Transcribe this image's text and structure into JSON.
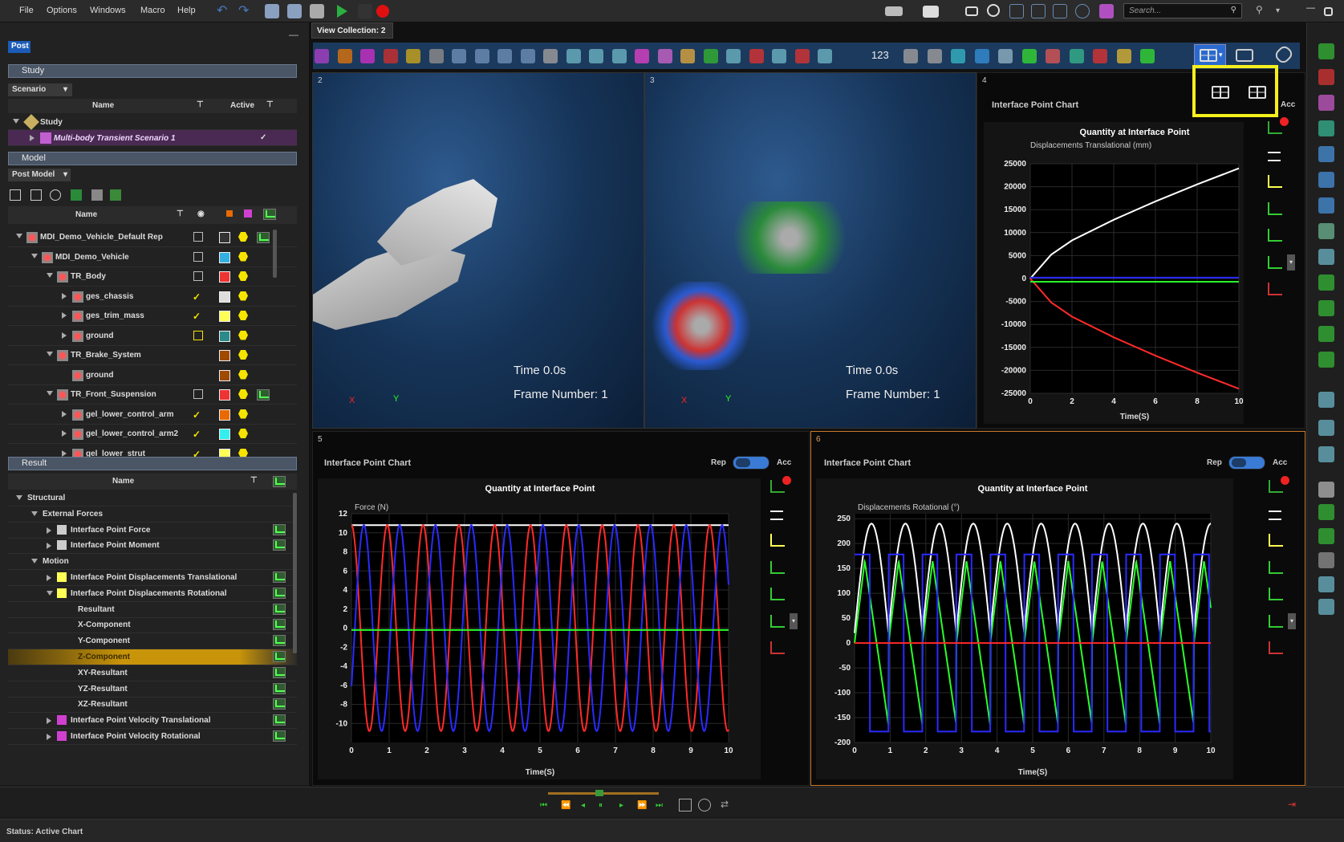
{
  "menu": {
    "file": "File",
    "options": "Options",
    "windows": "Windows",
    "macro": "Macro",
    "help": "Help",
    "search_placeholder": "Search..."
  },
  "tabs": {
    "post": "Post",
    "view_collection": "View Collection: 2"
  },
  "study": {
    "section": "Study",
    "scenario_dropdown": "Scenario",
    "col_name": "Name",
    "col_active": "Active",
    "root": "Study",
    "scenario": "Multi-body Transient Scenario 1",
    "active_mark": "✓"
  },
  "model": {
    "section": "Model",
    "dropdown": "Post Model",
    "col_name": "Name",
    "rows": [
      "MDI_Demo_Vehicle_Default Rep",
      "MDI_Demo_Vehicle",
      "TR_Body",
      "ges_chassis",
      "ges_trim_mass",
      "ground",
      "TR_Brake_System",
      "ground",
      "TR_Front_Suspension",
      "gel_lower_control_arm",
      "gel_lower_control_arm2",
      "gel_lower_strut"
    ]
  },
  "result": {
    "section": "Result",
    "col_name": "Name",
    "rows": [
      "Structural",
      "External Forces",
      "Interface Point Force",
      "Interface Point Moment",
      "Motion",
      "Interface Point Displacements Translational",
      "Interface Point Displacements Rotational",
      "Resultant",
      "X-Component",
      "Y-Component",
      "Z-Component",
      "XY-Resultant",
      "YZ-Resultant",
      "XZ-Resultant",
      "Interface Point Velocity Translational",
      "Interface Point Velocity Rotational"
    ]
  },
  "toolbar": {
    "counter": "123"
  },
  "views": {
    "v2": {
      "num": "2",
      "time": "Time  0.0s",
      "frame": "Frame  Number:  1",
      "axis_x": "X",
      "axis_y": "Y"
    },
    "v3": {
      "num": "3",
      "time": "Time  0.0s",
      "frame": "Frame  Number:  1",
      "axis_x": "X",
      "axis_y": "Y"
    }
  },
  "charts": {
    "c4": {
      "num": "4",
      "panel_title": "Interface Point Chart",
      "acc": "Acc"
    },
    "c5": {
      "num": "5",
      "panel_title": "Interface Point Chart",
      "rep": "Rep",
      "acc": "Acc"
    },
    "c6": {
      "num": "6",
      "panel_title": "Interface Point Chart",
      "rep": "Rep",
      "acc": "Acc"
    }
  },
  "chart_data": [
    {
      "type": "line",
      "title": "Quantity at Interface Point",
      "ylabel": "Displacements Translational (mm)",
      "xlabel": "Time(S)",
      "xlim": [
        0,
        10
      ],
      "ylim": [
        -25000,
        25000
      ],
      "xticks": [
        0,
        2,
        4,
        6,
        8,
        10
      ],
      "yticks": [
        25000,
        20000,
        15000,
        10000,
        5000,
        0,
        -5000,
        -10000,
        -15000,
        -20000,
        -25000
      ],
      "grid": true,
      "series": [
        {
          "color": "#ffffff",
          "x": [
            0,
            1,
            2,
            4,
            6,
            8,
            10
          ],
          "y": [
            0,
            5200,
            8300,
            12800,
            16800,
            20500,
            24000
          ]
        },
        {
          "color": "#ff2a2a",
          "x": [
            0,
            1,
            2,
            4,
            6,
            8,
            10
          ],
          "y": [
            0,
            -5200,
            -8300,
            -12800,
            -16800,
            -20500,
            -24000
          ]
        },
        {
          "color": "#2a2aff",
          "x": [
            0,
            10
          ],
          "y": [
            200,
            200
          ]
        },
        {
          "color": "#2aff2a",
          "x": [
            0,
            10
          ],
          "y": [
            -700,
            -700
          ]
        }
      ]
    },
    {
      "type": "line",
      "title": "Quantity at Interface Point",
      "ylabel": "Force (N)",
      "xlabel": "Time(S)",
      "xlim": [
        0,
        10
      ],
      "ylim": [
        -12,
        12
      ],
      "xticks": [
        0,
        1,
        2,
        3,
        4,
        5,
        6,
        7,
        8,
        9,
        10
      ],
      "yticks": [
        12,
        10,
        8,
        6,
        4,
        2,
        0,
        -2,
        -4,
        -6,
        -8,
        -10
      ],
      "grid": true,
      "series": [
        {
          "color": "#ffffff",
          "kind": "const",
          "value": 10.8
        },
        {
          "color": "#ff2a2a",
          "kind": "sine",
          "amp": 10.8,
          "period": 0.95,
          "phase": 1.5708
        },
        {
          "color": "#2a2aff",
          "kind": "sine",
          "amp": 10.8,
          "period": 0.95,
          "phase": -0.6
        },
        {
          "color": "#2aff2a",
          "kind": "const",
          "value": -0.2
        }
      ]
    },
    {
      "type": "line",
      "title": "Quantity at Interface Point",
      "ylabel": "Displacements Rotational (°)",
      "xlabel": "Time(S)",
      "xlim": [
        0,
        10
      ],
      "ylim": [
        -200,
        260
      ],
      "xticks": [
        0,
        1,
        2,
        3,
        4,
        5,
        6,
        7,
        8,
        9,
        10
      ],
      "yticks": [
        250,
        200,
        150,
        100,
        50,
        0,
        -50,
        -100,
        -150,
        -200
      ],
      "grid": true,
      "series": [
        {
          "color": "#ffffff",
          "kind": "abs",
          "amp": 240,
          "period": 1.0,
          "base": 20
        },
        {
          "color": "#2aff2a",
          "kind": "saw",
          "amp": 165,
          "period": 1.0
        },
        {
          "color": "#2a2aff",
          "kind": "square",
          "amp": 178,
          "period": 1.0
        },
        {
          "color": "#ff2a2a",
          "kind": "const",
          "value": 0
        }
      ]
    }
  ],
  "playback": {
    "left_label": "",
    "right_label": ""
  },
  "status": {
    "text": "Status:  Active Chart"
  }
}
